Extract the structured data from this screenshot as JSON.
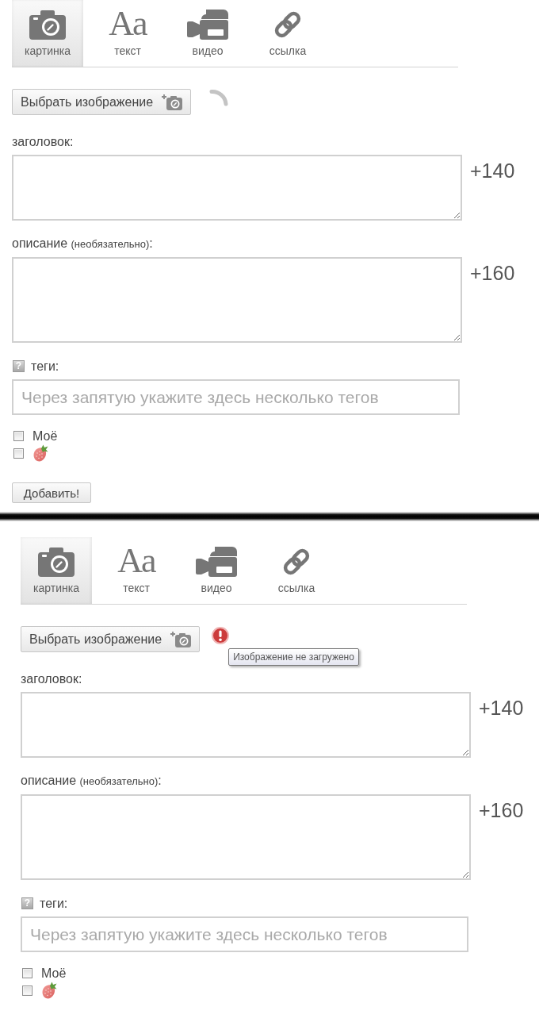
{
  "panels": [
    {
      "tabs": [
        {
          "label": "картинка",
          "kind": "camera",
          "selected": true
        },
        {
          "label": "текст",
          "kind": "letters",
          "glyph": "Aa",
          "selected": false
        },
        {
          "label": "видео",
          "kind": "video",
          "selected": false
        },
        {
          "label": "ссылка",
          "kind": "link",
          "selected": false
        }
      ],
      "image_button": {
        "label": "Выбрать изображение"
      },
      "upload_status": {
        "kind": "loading"
      },
      "title_field": {
        "label": "заголовок:",
        "counter": "+140"
      },
      "description_field": {
        "label": "описание",
        "note": "(необязательно)",
        "label_end": ":",
        "counter": "+160"
      },
      "tags_field": {
        "help_icon": "?",
        "label": "теги:",
        "placeholder": "Через запятую укажите здесь несколько тегов"
      },
      "options": [
        {
          "kind": "text",
          "label": "Моё",
          "checked": false
        },
        {
          "kind": "strawberry",
          "checked": false
        }
      ],
      "submit_button": {
        "label": "Добавить!"
      }
    },
    {
      "tabs": [
        {
          "label": "картинка",
          "kind": "camera",
          "selected": true
        },
        {
          "label": "текст",
          "kind": "letters",
          "glyph": "Aa",
          "selected": false
        },
        {
          "label": "видео",
          "kind": "video",
          "selected": false
        },
        {
          "label": "ссылка",
          "kind": "link",
          "selected": false
        }
      ],
      "image_button": {
        "label": "Выбрать изображение"
      },
      "upload_status": {
        "kind": "error",
        "tooltip": "Изображение не загружено"
      },
      "title_field": {
        "label": "заголовок:",
        "counter": "+140"
      },
      "description_field": {
        "label": "описание",
        "note": "(необязательно)",
        "label_end": ":",
        "counter": "+160"
      },
      "tags_field": {
        "help_icon": "?",
        "label": "теги:",
        "placeholder": "Через запятую укажите здесь несколько тегов"
      },
      "options": [
        {
          "kind": "text",
          "label": "Моё",
          "checked": false
        },
        {
          "kind": "strawberry",
          "checked": false
        }
      ]
    }
  ]
}
